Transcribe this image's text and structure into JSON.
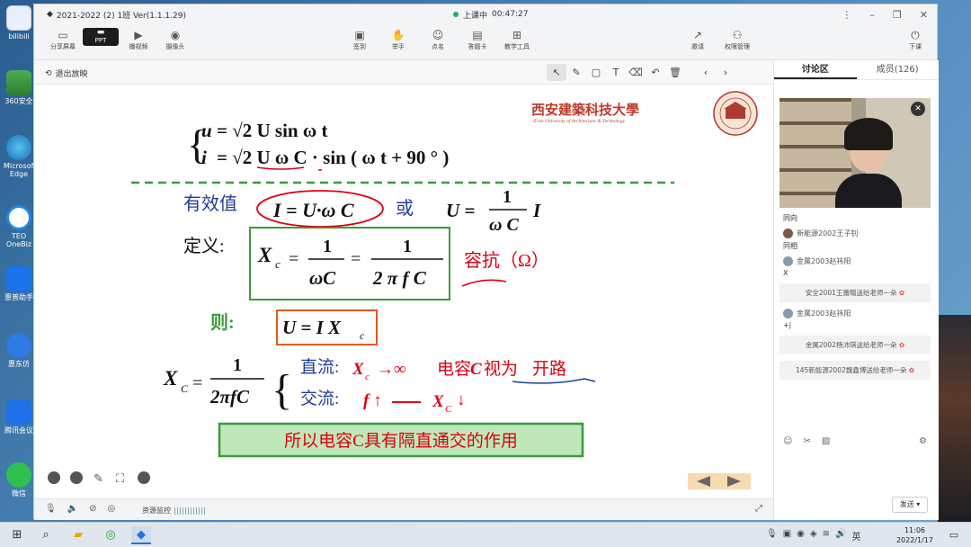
{
  "window": {
    "title": "2021-2022  (2)  1班 Ver(1.1.1.29)",
    "status": "上课中",
    "timer": "00:47:27"
  },
  "toolbar": {
    "left": [
      "分享屏幕",
      "PPT",
      "播视频",
      "摄像头"
    ],
    "middle": [
      "签到",
      "举手",
      "点名",
      "答题卡",
      "教学工具"
    ],
    "right": [
      "邀请",
      "权限管理",
      "下课"
    ]
  },
  "subbar": {
    "exit": "退出放映"
  },
  "slide": {
    "logo_cn": "西安建築科技大學",
    "logo_en": "Xi'an University of Architecture & Technology",
    "eq1_lhs": "u",
    "eq1_rhs": "= √2 U sin  ω t",
    "eq2_lhs": "i",
    "eq2_rhs": "= √2 U ω C · sin ( ω t + 90 ° )",
    "rms_label": "有效值",
    "rms_formula": "I = U·ω C",
    "or": "或",
    "rms_alt_lhs": "U =",
    "rms_alt_num": "1",
    "rms_alt_den": "ω C",
    "rms_alt_i": "I",
    "def_label": "定义:",
    "xc_lhs": "X",
    "xc_sub": "c",
    "frac1_num": "1",
    "frac1_den": "ωC",
    "frac2_num": "1",
    "frac2_den": "2 π f C",
    "reactance": "容抗（Ω）",
    "then_label": "则:",
    "then_formula": "U = I X",
    "then_sub": "c",
    "xc2_lhs": "X",
    "xc2_sub": "C",
    "xc2_num": "1",
    "xc2_den": "2πfC",
    "dc_label": "直流:",
    "dc_rest_1": "→∞",
    "dc_rest_2": "电容",
    "dc_rest_3": "C",
    "dc_rest_4": "视为",
    "dc_rest_5": "开路",
    "ac_label": "交流:",
    "ac_f": "f ↑",
    "ac_x": "X",
    "ac_x_sub": "C",
    "ac_down": "↓",
    "conclusion": "所以电容C具有隔直通交的作用"
  },
  "bottombar": {
    "monitor": "资源监控"
  },
  "panel": {
    "tabs": [
      "讨论区",
      "成员(126)"
    ],
    "messages": [
      {
        "type": "text",
        "text": "同向"
      },
      {
        "type": "user",
        "user": "新能源2002王子钊",
        "text": "同相"
      },
      {
        "type": "user",
        "user": "金属2003赵祎阳",
        "text": "X"
      },
      {
        "type": "gift",
        "text": "安全2001王蕾赠送给老师一朵"
      },
      {
        "type": "user",
        "user": "金属2003赵祎阳",
        "text": "+j"
      },
      {
        "type": "gift",
        "text": "金属2002杨沛琪送给老师一朵"
      },
      {
        "type": "gift",
        "text": "145新能源2002魏鑫博送给老师一朵"
      }
    ],
    "send": "发送"
  },
  "desktop": {
    "icons": [
      "bilibili",
      "360安全",
      "Microsoft Edge",
      "TEO OneBiz",
      "惠普助手",
      "惠东仿",
      "腾讯会议",
      "微信"
    ]
  },
  "taskbar": {
    "time": "11:06",
    "date": "2022/1/17"
  }
}
